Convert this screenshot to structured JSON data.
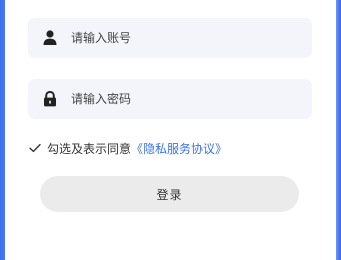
{
  "form": {
    "username": {
      "icon": "user-icon",
      "placeholder": "请输入账号",
      "value": ""
    },
    "password": {
      "icon": "lock-icon",
      "placeholder": "请输入密码",
      "value": ""
    },
    "agreement": {
      "checked": true,
      "text": "勾选及表示同意",
      "link_text": "《隐私服务协议》",
      "link_color": "#3b72ec"
    },
    "login_button": {
      "label": "登录",
      "background": "#ebebeb"
    }
  },
  "colors": {
    "field_background": "#f3f5fa",
    "side_accent": "#3e6fef"
  }
}
